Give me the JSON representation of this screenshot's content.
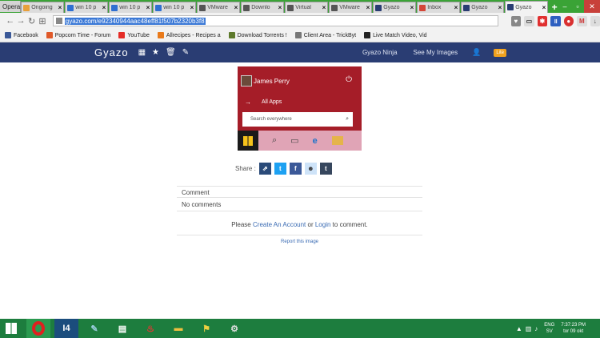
{
  "browser": {
    "menu_label": "Opera",
    "tabs": [
      {
        "label": "Ongoing",
        "color": "#e8a03a"
      },
      {
        "label": "win 10 p",
        "color": "#2f6fd1"
      },
      {
        "label": "win 10 p",
        "color": "#2f6fd1"
      },
      {
        "label": "win 10 p",
        "color": "#2f6fd1"
      },
      {
        "label": "VMware",
        "color": "#555555"
      },
      {
        "label": "Downlo",
        "color": "#555555"
      },
      {
        "label": "Virtual",
        "color": "#555555"
      },
      {
        "label": "VMware",
        "color": "#555555"
      },
      {
        "label": "Gyazo",
        "color": "#2a3d73"
      },
      {
        "label": "Inbox",
        "color": "#d44638"
      },
      {
        "label": "Gyazo",
        "color": "#2a3d73"
      },
      {
        "label": "Gyazo",
        "color": "#2a3d73"
      }
    ],
    "new_tab": "+",
    "url": "gyazo.com/e92340944aac48eff81f507b2320b3f8",
    "bookmarks": [
      {
        "label": "Facebook",
        "color": "#3b5998"
      },
      {
        "label": "Popcorn Time - Forum",
        "color": "#e05a2a"
      },
      {
        "label": "YouTube",
        "color": "#e52d27"
      },
      {
        "label": "Allrecipes - Recipes a",
        "color": "#e97a1a"
      },
      {
        "label": "Download Torrents !",
        "color": "#5e7a2c"
      },
      {
        "label": "Client Area - TrickByt",
        "color": "#777777"
      },
      {
        "label": "Live Match Video, Vid",
        "color": "#222222"
      }
    ]
  },
  "gyazo": {
    "logo": "Gyazo",
    "nav": {
      "ninja": "Gyazo Ninja",
      "my_images": "See My Images",
      "lite": "Lite"
    },
    "image": {
      "user_name": "James Perry",
      "all_apps": "All Apps",
      "search_placeholder": "Search everywhere"
    },
    "share_label": "Share :",
    "share_buttons": [
      {
        "name": "share-link",
        "color": "#2a4a78"
      },
      {
        "name": "twitter",
        "color": "#1da1f2"
      },
      {
        "name": "facebook",
        "color": "#3b5998"
      },
      {
        "name": "reddit",
        "color": "#cee3f8"
      },
      {
        "name": "tumblr",
        "color": "#36465d"
      }
    ],
    "comment_label": "Comment",
    "no_comments": "No comments",
    "prompt_pre": "Please",
    "create_account": "Create An Account",
    "prompt_or": "or",
    "login": "Login",
    "prompt_post": "to comment.",
    "report": "Report this image"
  },
  "taskbar": {
    "lang": "ENG",
    "locale": "SV",
    "time": "7:37:23 PM",
    "date": "tor 09 okt"
  }
}
